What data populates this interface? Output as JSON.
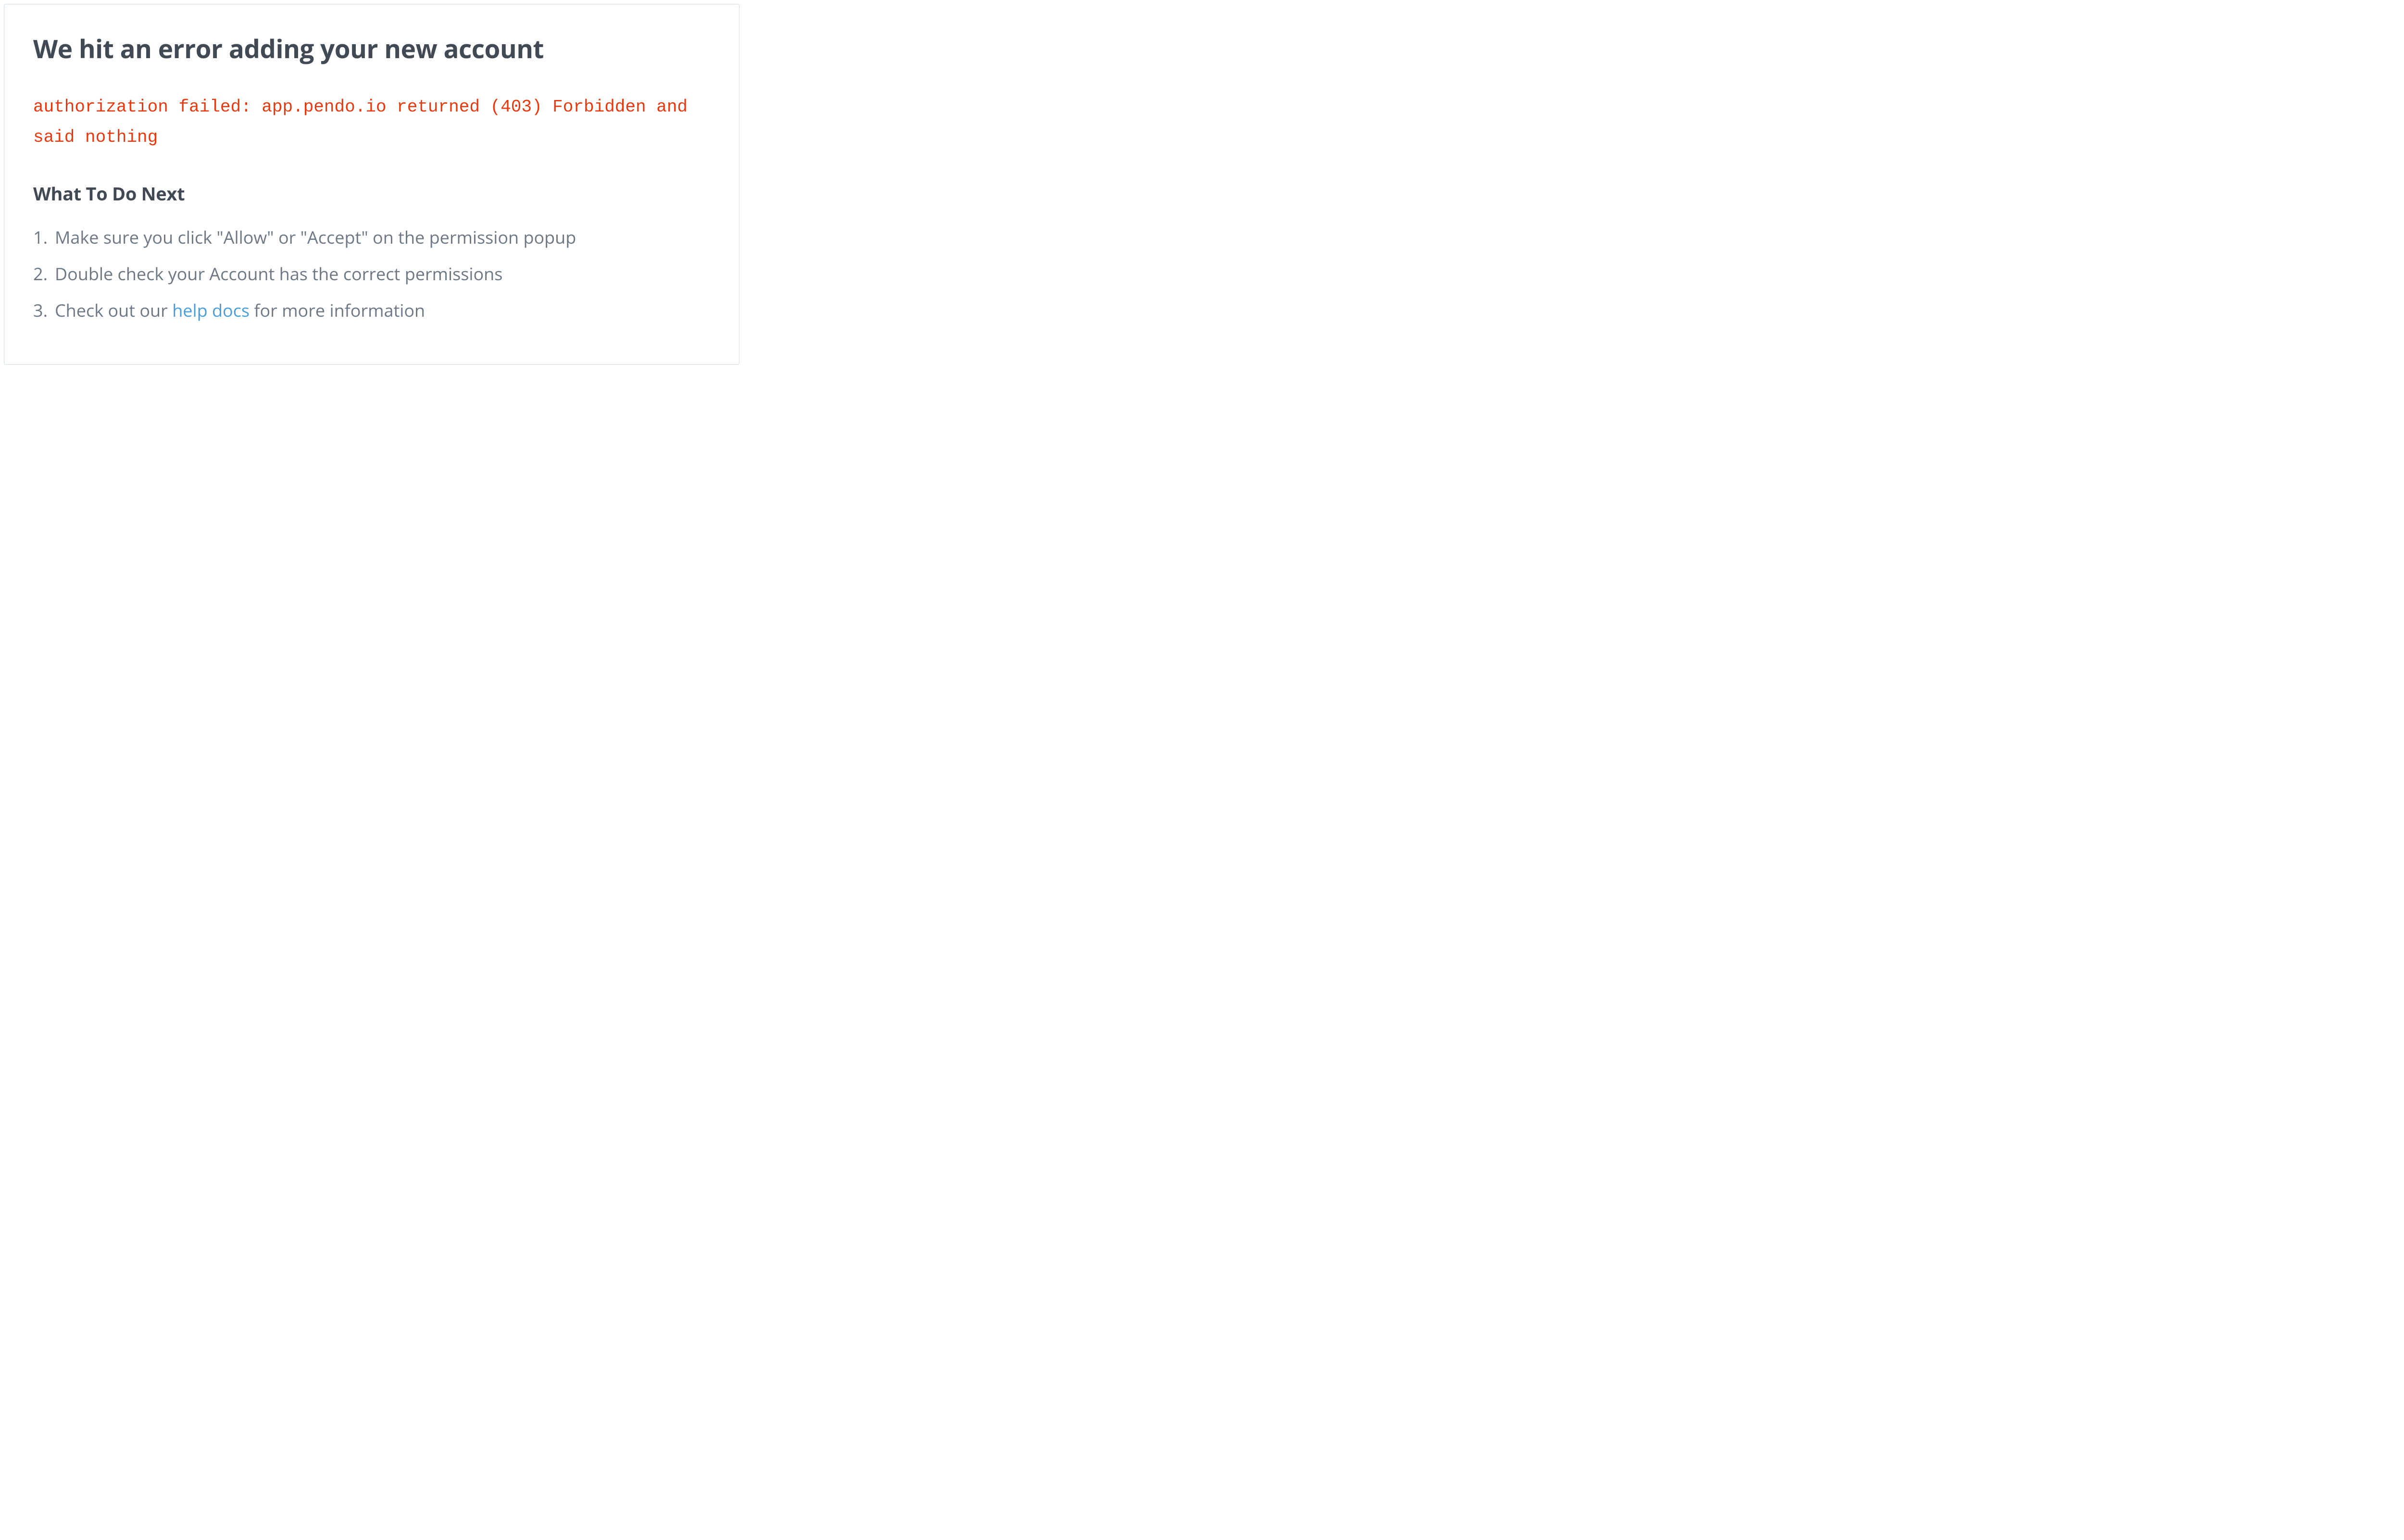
{
  "error": {
    "title": "We hit an error adding your new account",
    "message": "authorization failed: app.pendo.io returned (403) Forbidden and said nothing"
  },
  "next_steps": {
    "heading": "What To Do Next",
    "items": [
      "Make sure you click \"Allow\" or \"Accept\" on the permission popup",
      "Double check your Account has the correct permissions"
    ],
    "item3_prefix": "Check out our ",
    "item3_link": "help docs",
    "item3_suffix": " for more information"
  }
}
